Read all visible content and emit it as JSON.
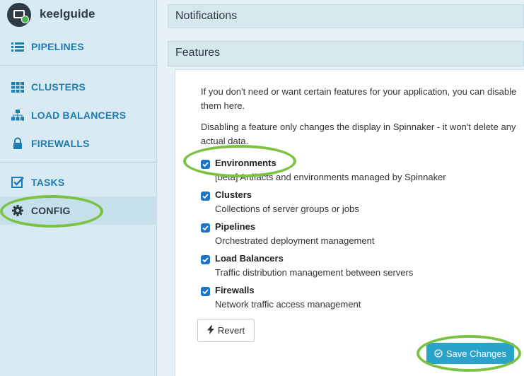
{
  "app": {
    "name": "keelguide"
  },
  "sidebar": {
    "items": [
      {
        "label": "PIPELINES",
        "icon": "list-icon"
      },
      {
        "label": "CLUSTERS",
        "icon": "grid-icon"
      },
      {
        "label": "LOAD BALANCERS",
        "icon": "sitemap-icon"
      },
      {
        "label": "FIREWALLS",
        "icon": "lock-icon"
      },
      {
        "label": "TASKS",
        "icon": "checkbox-icon"
      },
      {
        "label": "CONFIG",
        "icon": "gear-icon",
        "active": true
      }
    ]
  },
  "main": {
    "sections": [
      {
        "title": "Notifications"
      },
      {
        "title": "Features"
      }
    ],
    "features": {
      "intro": "If you don't need or want certain features for your application, you can disable them here.",
      "note": "Disabling a feature only changes the display in Spinnaker - it won't delete any actual data.",
      "items": [
        {
          "name": "Environments",
          "description": "[beta] Artifacts and environments managed by Spinnaker",
          "checked": true
        },
        {
          "name": "Clusters",
          "description": "Collections of server groups or jobs",
          "checked": true
        },
        {
          "name": "Pipelines",
          "description": "Orchestrated deployment management",
          "checked": true
        },
        {
          "name": "Load Balancers",
          "description": "Traffic distribution management between servers",
          "checked": true
        },
        {
          "name": "Firewalls",
          "description": "Network traffic access management",
          "checked": true
        }
      ],
      "revert_label": "Revert",
      "save_label": "Save Changes"
    }
  },
  "colors": {
    "accent": "#1c7db0",
    "save_button": "#2aa3c8",
    "checkbox": "#1f72c4",
    "annotation": "#7cc242"
  }
}
